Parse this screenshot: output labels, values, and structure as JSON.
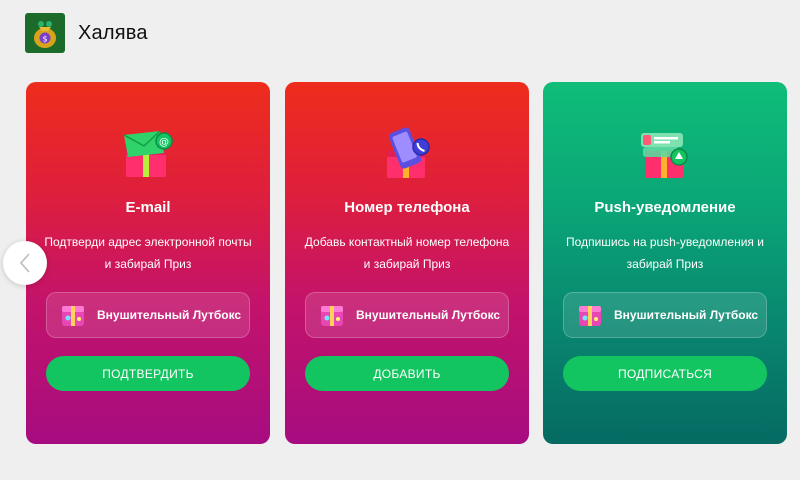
{
  "header": {
    "title": "Халява",
    "logo_icon": "money-bag-icon"
  },
  "carousel": {
    "prev_icon": "chevron-left-icon"
  },
  "cards": [
    {
      "title": "E-mail",
      "description": "Подтверди адрес электронной почты и забирай Приз",
      "reward_label": "Внушительный Лутбокс",
      "button_label": "ПОДТВЕРДИТЬ",
      "icon": "email-gift-icon",
      "theme": "red"
    },
    {
      "title": "Номер телефона",
      "description": "Добавь контактный номер телефона и забирай Приз",
      "reward_label": "Внушительный Лутбокс",
      "button_label": "ДОБАВИТЬ",
      "icon": "phone-gift-icon",
      "theme": "red"
    },
    {
      "title": "Push-уведомление",
      "description": "Подпишись на push-уведомления и забирай Приз",
      "reward_label": "Внушительный Лутбокс",
      "button_label": "ПОДПИСАТЬСЯ",
      "icon": "notification-gift-icon",
      "theme": "green"
    }
  ],
  "colors": {
    "red_top": "#ee2d1c",
    "red_bottom": "#a60c80",
    "green_top": "#0fbd78",
    "green_bottom": "#066a62",
    "button": "#13c561"
  }
}
